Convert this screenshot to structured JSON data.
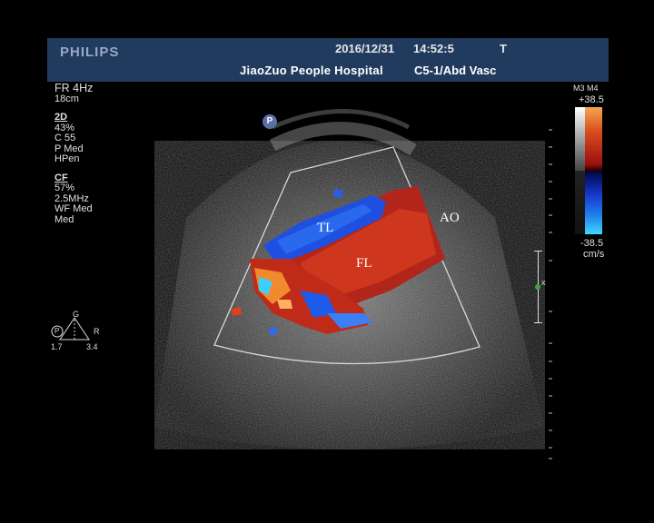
{
  "header": {
    "brand": "PHILIPS",
    "date": "2016/12/31",
    "time": "14:52:5",
    "mi": "T",
    "hospital": "JiaoZuo  People Hospital",
    "preset": "C5-1/Abd Vasc"
  },
  "params": {
    "frame_rate": "FR 4Hz",
    "depth": "18cm",
    "mode_2d": {
      "title": "2D",
      "gain": "43%",
      "compression": "C 55",
      "power": "P Med",
      "harmonics": "HPen"
    },
    "mode_cf": {
      "title": "CF",
      "gain": "57%",
      "frequency": "2.5MHz",
      "wall_filter": "WF Med",
      "setting": "Med"
    }
  },
  "color_scale": {
    "map": "M3 M4",
    "max": "+38.5",
    "min": "-38.5",
    "unit": "cm/s"
  },
  "badge": {
    "pp": "P"
  },
  "annotations": {
    "tl": "TL",
    "fl": "FL",
    "ao": "AO"
  },
  "orientation": {
    "p": "P",
    "g": "G",
    "r": "R",
    "left_value": "1.7",
    "right_value": "3.4"
  },
  "depth_marker": {
    "label": "x"
  }
}
